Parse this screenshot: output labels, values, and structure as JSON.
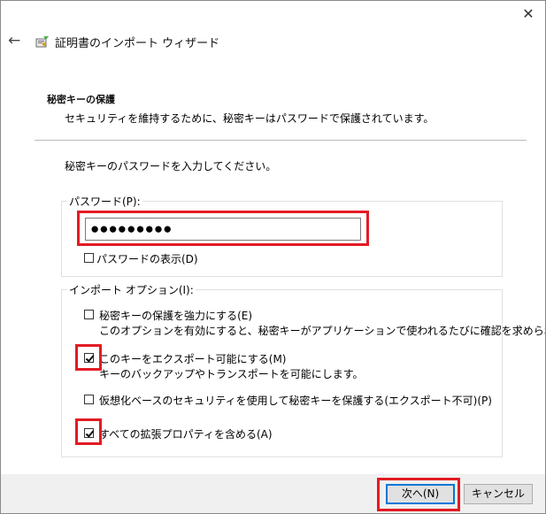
{
  "window": {
    "close_glyph": "✕",
    "back_glyph": "←",
    "title": "証明書のインポート ウィザード"
  },
  "header": {
    "section_title": "秘密キーの保護",
    "section_desc": "セキュリティを維持するために、秘密キーはパスワードで保護されています。"
  },
  "body": {
    "instruction": "秘密キーのパスワードを入力してください。"
  },
  "password_group": {
    "label": "パスワード(P):",
    "value": "●●●●●●●●●",
    "show_password": {
      "label": "パスワードの表示(D)",
      "checked": false
    }
  },
  "options_group": {
    "label": "インポート オプション(I):",
    "options": [
      {
        "label": "秘密キーの保護を強力にする(E)",
        "sub": "このオプションを有効にすると、秘密キーがアプリケーションで使われるたびに確認を求められます。",
        "checked": false
      },
      {
        "label": "このキーをエクスポート可能にする(M)",
        "sub": "キーのバックアップやトランスポートを可能にします。",
        "checked": true
      },
      {
        "label": "仮想化ベースのセキュリティを使用して秘密キーを保護する(エクスポート不可)(P)",
        "sub": "",
        "checked": false
      },
      {
        "label": "すべての拡張プロパティを含める(A)",
        "sub": "",
        "checked": true
      }
    ]
  },
  "footer": {
    "next_label": "次へ(N)",
    "cancel_label": "キャンセル"
  },
  "colors": {
    "highlight": "#e31b23",
    "accent": "#0078d7",
    "footer_bg": "#f0f0f0"
  }
}
